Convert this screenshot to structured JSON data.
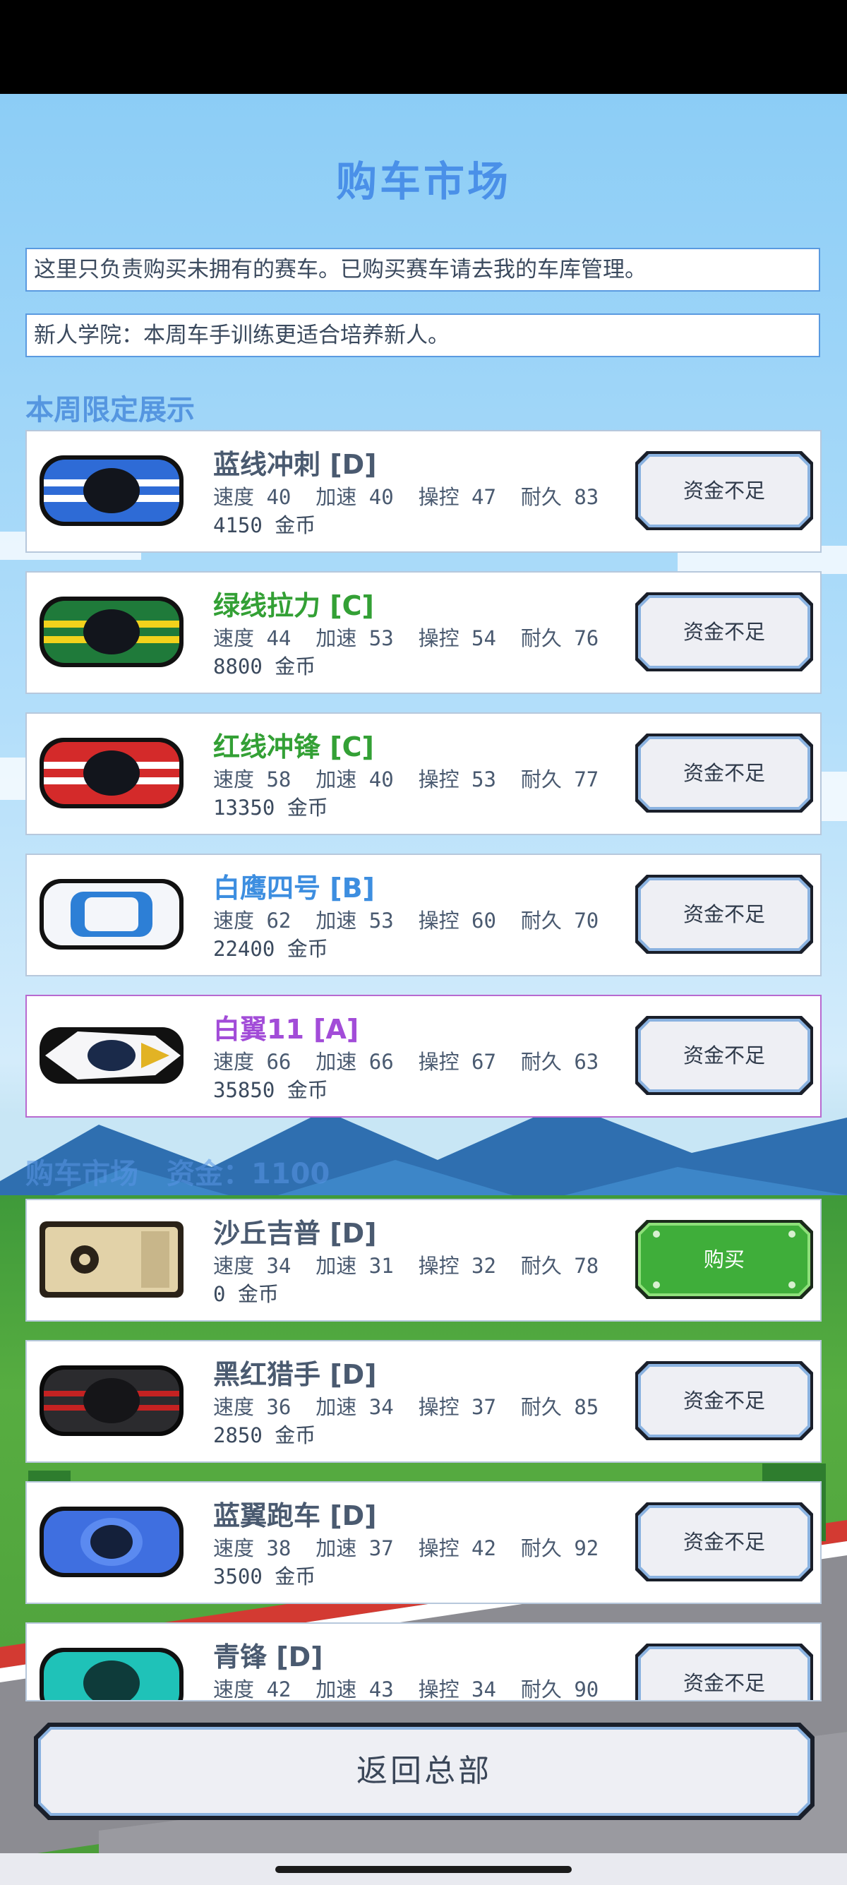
{
  "title": "购车市场",
  "notices": [
    "这里只负责购买未拥有的赛车。已购买赛车请去我的车库管理。",
    "新人学院：本周车手训练更适合培养新人。"
  ],
  "featured_title": "本周限定展示",
  "market_title": "购车市场　资金：1100",
  "back_label": "返回总部",
  "colors": {
    "accent": "#4a90e8",
    "buy_green": "#3fae3a",
    "card_border": "#b7c8dc"
  },
  "featured": [
    {
      "name": "蓝线冲刺 [D]",
      "stats": "速度 40  加速 40  操控 47  耐久 83",
      "price": "4150 金币",
      "button": "资金不足",
      "icon": "blue-striped-car-icon"
    },
    {
      "name": "绿线拉力 [C]",
      "stats": "速度 44  加速 53  操控 54  耐久 76",
      "price": "8800 金币",
      "button": "资金不足",
      "icon": "green-rally-car-icon"
    },
    {
      "name": "红线冲锋 [C]",
      "stats": "速度 58  加速 40  操控 53  耐久 77",
      "price": "13350 金币",
      "button": "资金不足",
      "icon": "red-striped-car-icon"
    },
    {
      "name": "白鹰四号 [B]",
      "stats": "速度 62  加速 53  操控 60  耐久 70",
      "price": "22400 金币",
      "button": "资金不足",
      "icon": "white-car-icon"
    },
    {
      "name": "白翼11 [A]",
      "stats": "速度 66  加速 66  操控 67  耐久 63",
      "price": "35850 金币",
      "button": "资金不足",
      "icon": "white-formula-car-icon"
    }
  ],
  "market": [
    {
      "name": "沙丘吉普 [D]",
      "stats": "速度 34  加速 31  操控 32  耐久 78",
      "price": "0 金币",
      "button": "购买",
      "icon": "dune-jeep-icon"
    },
    {
      "name": "黑红猎手 [D]",
      "stats": "速度 36  加速 34  操控 37  耐久 85",
      "price": "2850 金币",
      "button": "资金不足",
      "icon": "black-red-car-icon"
    },
    {
      "name": "蓝翼跑车 [D]",
      "stats": "速度 38  加速 37  操控 42  耐久 92",
      "price": "3500 金币",
      "button": "资金不足",
      "icon": "blue-sports-car-icon"
    },
    {
      "name": "青锋 [D]",
      "stats": "速度 42  加速 43  操控 34  耐久 90",
      "price": "",
      "button": "资金不足",
      "icon": "teal-car-icon"
    }
  ]
}
